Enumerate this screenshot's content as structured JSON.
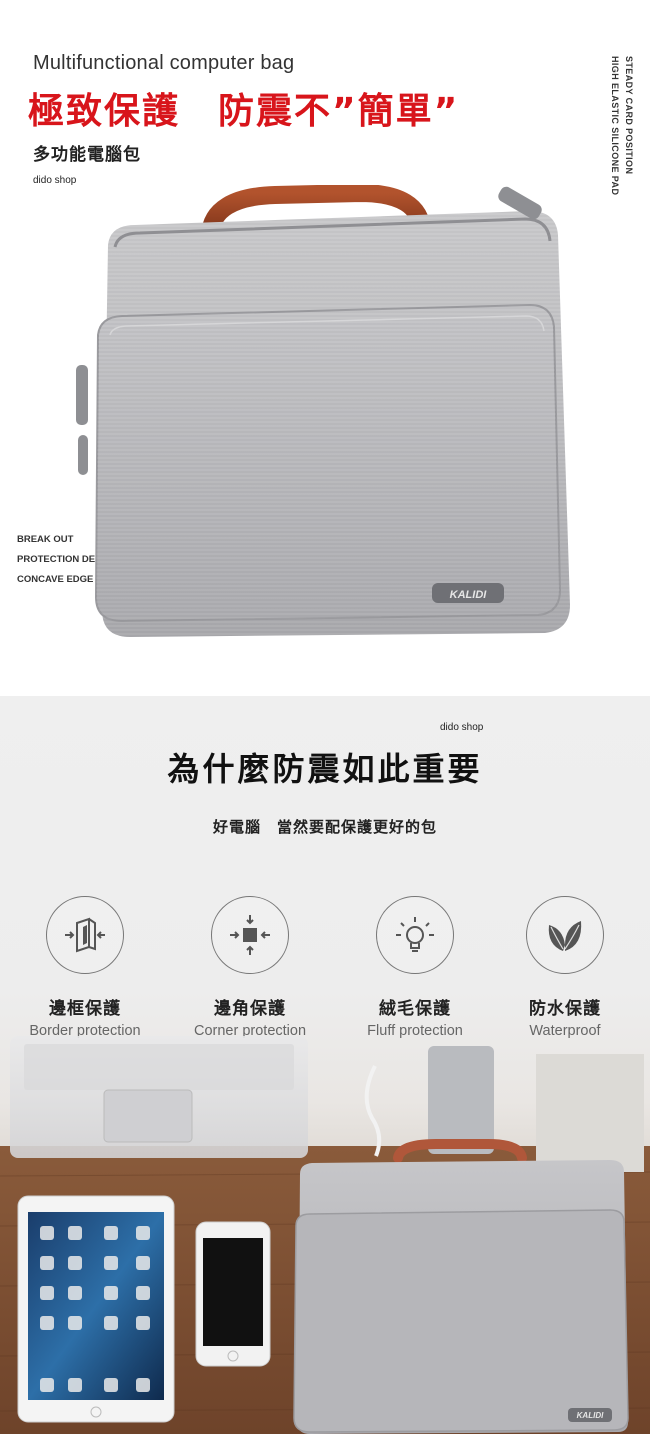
{
  "top": {
    "en_title": "Multifunctional computer bag",
    "zh_headline": "極致保護　防震不”簡單”",
    "zh_sub": "多功能電腦包",
    "shop_tag": "dido shop",
    "vertical_1": "STEADY CARD POSITION",
    "vertical_2": "HIGH ELASTIC SILICONE PAD",
    "side_notes": [
      "BREAK OUT",
      "PROTECTION DESIGN",
      "CONCAVE EDGE"
    ],
    "bag_logo": "KALIDI",
    "headline_color": "#d8151b"
  },
  "bottom": {
    "shop_tag": "dido shop",
    "title": "為什麼防震如此重要",
    "subtitle": "好電腦　當然要配保護更好的包",
    "features": [
      {
        "icon": "border-protection-icon",
        "zh": "邊框保護",
        "en": "Border protection"
      },
      {
        "icon": "corner-protection-icon",
        "zh": "邊角保護",
        "en": "Corner protection"
      },
      {
        "icon": "lightbulb-icon",
        "zh": "絨毛保護",
        "en": "Fluff protection"
      },
      {
        "icon": "leaves-icon",
        "zh": "防水保護",
        "en": "Waterproof"
      }
    ],
    "scene_bag_logo": "KALIDI"
  }
}
